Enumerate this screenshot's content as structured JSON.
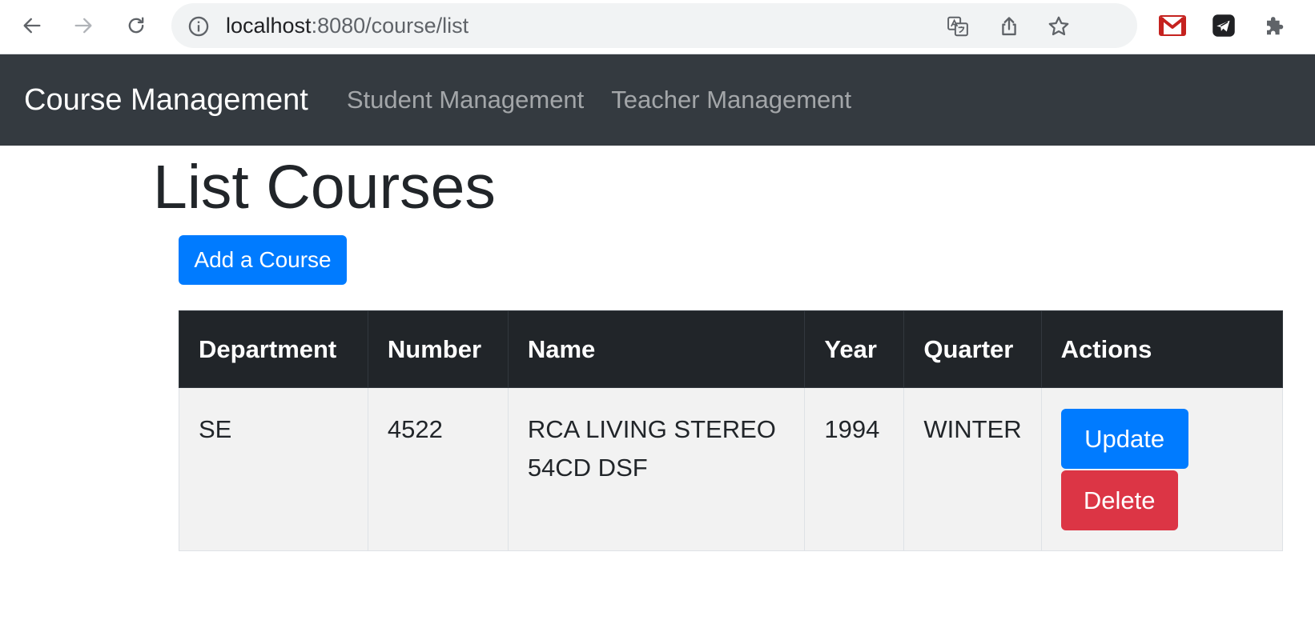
{
  "browser": {
    "url_host": "localhost",
    "url_rest": ":8080/course/list",
    "icons": {
      "back": "arrow-left-icon",
      "forward": "arrow-right-icon",
      "reload": "reload-icon",
      "info": "info-icon",
      "translate": "translate-icon",
      "share": "share-icon",
      "bookmark": "star-icon",
      "gmail": "gmail-icon",
      "telegram": "telegram-icon",
      "extensions": "puzzle-icon"
    }
  },
  "navbar": {
    "brand": "Course Management",
    "links": [
      "Student Management",
      "Teacher Management"
    ]
  },
  "main": {
    "title": "List Courses",
    "add_button": "Add a Course"
  },
  "table": {
    "headers": [
      "Department",
      "Number",
      "Name",
      "Year",
      "Quarter",
      "Actions"
    ],
    "rows": [
      {
        "department": "SE",
        "number": "4522",
        "name": "RCA LIVING STEREO 54CD DSF",
        "year": "1994",
        "quarter": "WINTER",
        "update_label": "Update",
        "delete_label": "Delete"
      }
    ]
  },
  "colors": {
    "navbar_bg": "#343a40",
    "primary": "#007bff",
    "danger": "#dc3545",
    "table_head_bg": "#212529"
  }
}
